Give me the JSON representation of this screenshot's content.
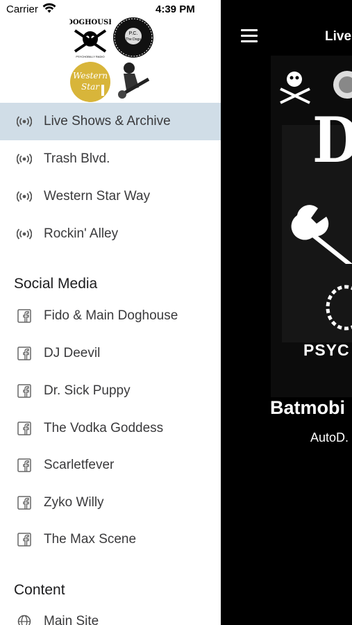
{
  "status_bar": {
    "carrier": "Carrier",
    "time": "4:39 PM"
  },
  "drawer": {
    "logos": [
      "doghouse-logo",
      "pc-the-dogs-logo",
      "western-star-logo",
      "rockabilly-dog-logo"
    ],
    "stations": [
      {
        "label": "Live Shows & Archive",
        "icon": "radio-broadcast-icon",
        "active": true
      },
      {
        "label": "Trash Blvd.",
        "icon": "radio-broadcast-icon",
        "active": false
      },
      {
        "label": "Western Star Way",
        "icon": "radio-broadcast-icon",
        "active": false
      },
      {
        "label": "Rockin' Alley",
        "icon": "radio-broadcast-icon",
        "active": false
      }
    ],
    "social_title": "Social Media",
    "social": [
      {
        "label": "Fido & Main Doghouse",
        "icon": "facebook-icon"
      },
      {
        "label": "DJ Deevil",
        "icon": "facebook-icon"
      },
      {
        "label": "Dr. Sick Puppy",
        "icon": "facebook-icon"
      },
      {
        "label": "The Vodka Goddess",
        "icon": "facebook-icon"
      },
      {
        "label": "Scarletfever",
        "icon": "facebook-icon"
      },
      {
        "label": "Zyko Willy",
        "icon": "facebook-icon"
      },
      {
        "label": "The Max Scene",
        "icon": "facebook-icon"
      }
    ],
    "content_title": "Content",
    "content": [
      {
        "label": "Main Site",
        "icon": "globe-icon"
      }
    ]
  },
  "main": {
    "nav_title": "Live",
    "album_art_text": "DO",
    "album_art_subtext": "PSYC",
    "song_title": "Batmobi",
    "song_artist": "AutoD."
  },
  "colors": {
    "active_row": "#d0dde7",
    "main_bg": "#000000",
    "western_star_gold": "#d8b53a"
  }
}
